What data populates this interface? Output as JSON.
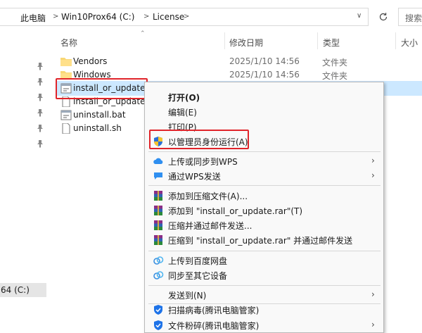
{
  "address": {
    "crumbs": [
      "此电脑",
      "Win10Prox64 (C:)",
      "License"
    ],
    "search_placeholder": "搜索"
  },
  "columns": {
    "name": "名称",
    "date": "修改日期",
    "type": "类型",
    "size": "大小"
  },
  "files": [
    {
      "name": "Vendors",
      "date": "2025/1/10 14:56",
      "type": "文件夹",
      "icon": "folder-icon"
    },
    {
      "name": "Windows",
      "date": "2025/1/10 14:56",
      "type": "文件夹",
      "icon": "folder-icon"
    },
    {
      "name": "install_or_update.bat",
      "date": "",
      "type": "",
      "icon": "batch-file-icon",
      "selected": true
    },
    {
      "name": "install_or_update.sh",
      "date": "",
      "type": "",
      "icon": "text-file-icon"
    },
    {
      "name": "uninstall.bat",
      "date": "",
      "type": "",
      "icon": "batch-file-icon"
    },
    {
      "name": "uninstall.sh",
      "date": "",
      "type": "",
      "icon": "text-file-icon"
    }
  ],
  "nav": {
    "drive_label": "64 (C:)"
  },
  "menu": {
    "open": "打开(O)",
    "edit": "编辑(E)",
    "print": "打印(P)",
    "run_as_admin": "以管理员身份运行(A)",
    "wps_upload_sync": "上传或同步到WPS",
    "wps_send": "通过WPS发送",
    "add_to_archive": "添加到压缩文件(A)...",
    "add_to_rar": "添加到 \"install_or_update.rar\"(T)",
    "compress_email": "压缩并通过邮件发送...",
    "compress_rar_email": "压缩到 \"install_or_update.rar\" 并通过邮件发送",
    "upload_baidu": "上传到百度网盘",
    "sync_devices": "同步至其它设备",
    "send_to": "发送到(N)",
    "scan_virus": "扫描病毒(腾讯电脑管家)",
    "shred_file": "文件粉碎(腾讯电脑管家)"
  },
  "colors": {
    "highlight_red": "#e0242a",
    "selection": "#cce8ff",
    "folder": "#f8d775"
  }
}
